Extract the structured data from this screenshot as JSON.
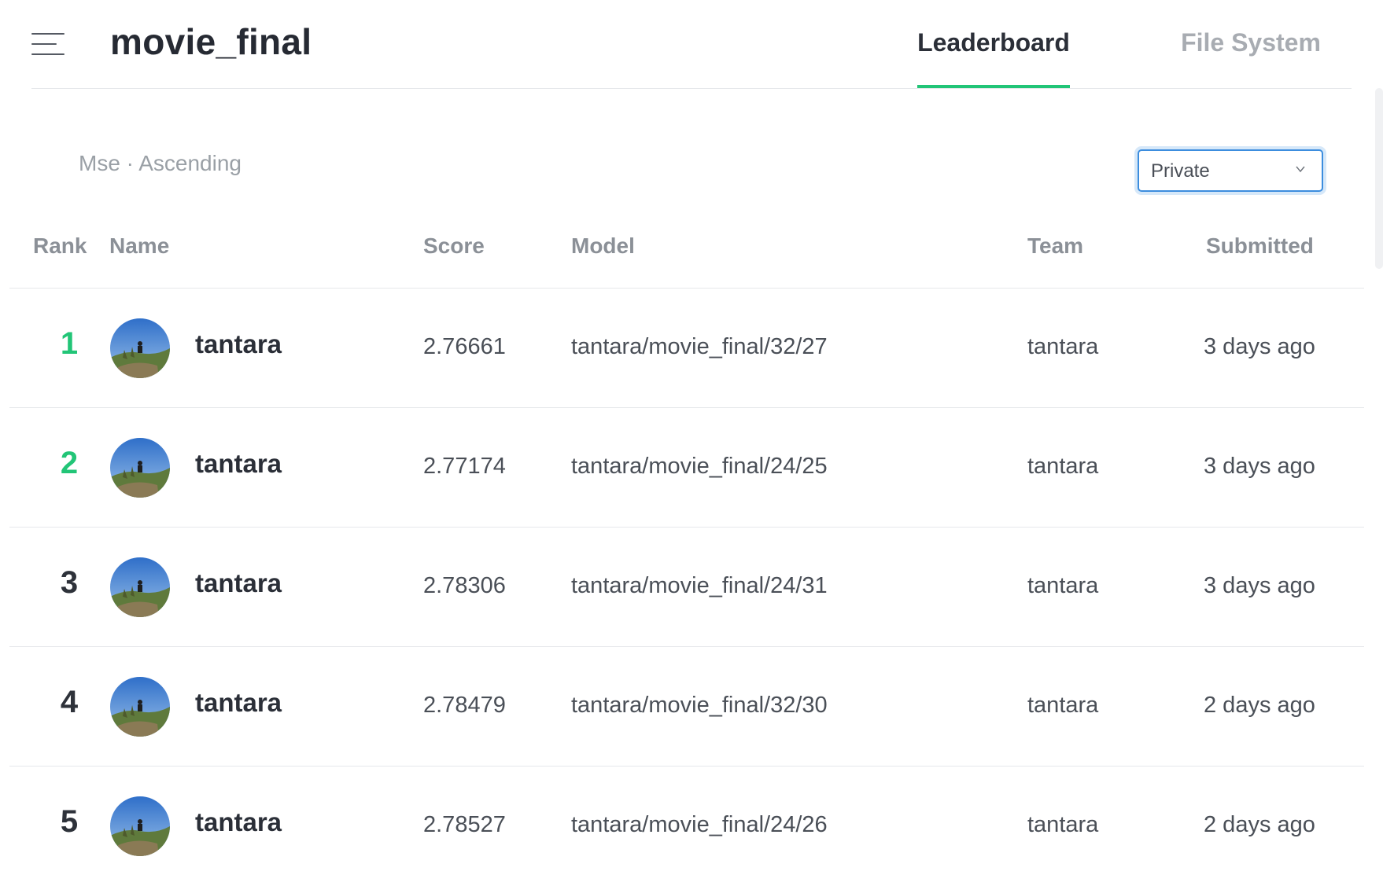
{
  "header": {
    "title": "movie_final",
    "tabs": [
      {
        "label": "Leaderboard",
        "active": true
      },
      {
        "label": "File System",
        "active": false
      }
    ]
  },
  "sort": {
    "metric": "Mse",
    "order": "Ascending",
    "label": "Mse · Ascending"
  },
  "visibility_select": {
    "value": "Private"
  },
  "columns": [
    "Rank",
    "Name",
    "Score",
    "Model",
    "Team",
    "Submitted"
  ],
  "rows": [
    {
      "rank": "1",
      "name": "tantara",
      "score": "2.76661",
      "model": "tantara/movie_final/32/27",
      "team": "tantara",
      "submitted": "3 days ago"
    },
    {
      "rank": "2",
      "name": "tantara",
      "score": "2.77174",
      "model": "tantara/movie_final/24/25",
      "team": "tantara",
      "submitted": "3 days ago"
    },
    {
      "rank": "3",
      "name": "tantara",
      "score": "2.78306",
      "model": "tantara/movie_final/24/31",
      "team": "tantara",
      "submitted": "3 days ago"
    },
    {
      "rank": "4",
      "name": "tantara",
      "score": "2.78479",
      "model": "tantara/movie_final/32/30",
      "team": "tantara",
      "submitted": "2 days ago"
    },
    {
      "rank": "5",
      "name": "tantara",
      "score": "2.78527",
      "model": "tantara/movie_final/24/26",
      "team": "tantara",
      "submitted": "2 days ago"
    }
  ],
  "colors": {
    "accent": "#22c577",
    "select_border": "#3c8dde"
  },
  "icons": {
    "menu": "hamburger-menu-icon",
    "dropdown": "chevron-down-icon"
  }
}
